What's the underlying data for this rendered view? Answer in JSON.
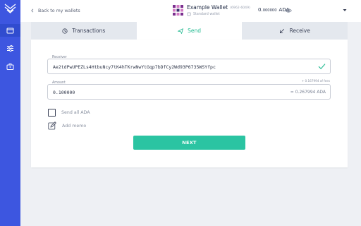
{
  "header": {
    "back_label": "Back to my wallets",
    "wallet_name": "Example Wallet",
    "wallet_id": "(6962-6049)",
    "wallet_type": "Standard wallet",
    "balance_int": "0.",
    "balance_dec": "000000",
    "balance_unit": "ADA"
  },
  "sidebar": {
    "items": [
      {
        "icon": "wallet-icon",
        "active": true
      },
      {
        "icon": "sliders-icon",
        "active": false
      },
      {
        "icon": "briefcase-icon",
        "active": false
      }
    ]
  },
  "tabs": [
    {
      "label": "Transactions",
      "icon": "clock-icon",
      "active": false
    },
    {
      "label": "Send",
      "icon": "send-icon",
      "active": true
    },
    {
      "label": "Receive",
      "icon": "receive-arrow-icon",
      "active": false
    }
  ],
  "send_form": {
    "receiver_label": "Receiver",
    "receiver_value": "Ae2tdPwUPEZLs4HtbuNcy7tK4hTKrwNwYtGqp7bDfCy2Wd93P6735WSYfpc",
    "amount_label": "Amount",
    "fee_hint": "+ 0.167994 of fees",
    "amount_value": "0.100000",
    "amount_equiv": "= 0.267994 ADA",
    "send_all_label": "Send all ADA",
    "add_memo_label": "Add memo",
    "next_label": "NEXT"
  },
  "colors": {
    "sidebar": "#3d56e0",
    "accent": "#2bc4a2",
    "active_tab_text": "#1fb98f",
    "background": "#eef0f4"
  }
}
